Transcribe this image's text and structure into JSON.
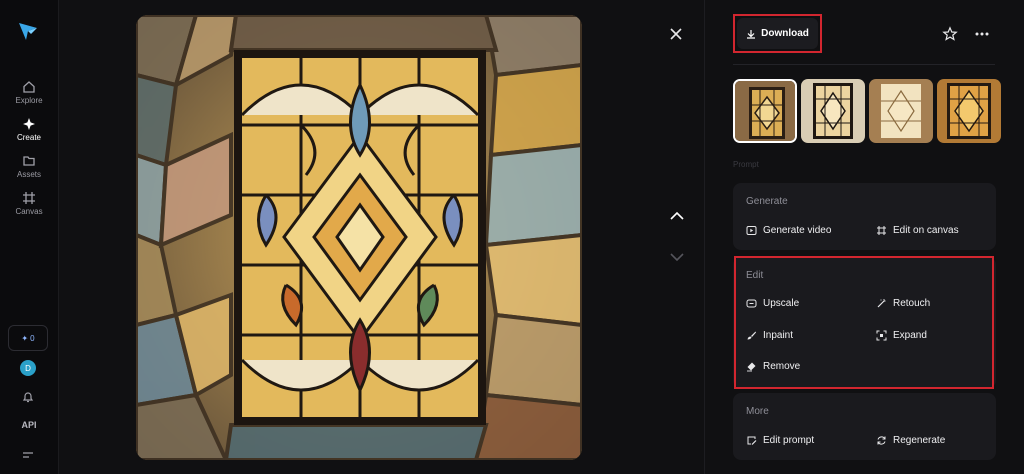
{
  "sidebar": {
    "items": [
      {
        "label": "Explore",
        "icon": "home-icon"
      },
      {
        "label": "Create",
        "icon": "sparkle-icon"
      },
      {
        "label": "Assets",
        "icon": "folder-icon"
      },
      {
        "label": "Canvas",
        "icon": "canvas-icon"
      }
    ],
    "credits": "0",
    "avatar_initial": "D",
    "api_label": "API"
  },
  "toolbar": {
    "download_label": "Download"
  },
  "panel": {
    "prompt_label": "Prompt",
    "generate": {
      "title": "Generate",
      "actions": [
        {
          "label": "Generate video",
          "icon": "video-icon"
        },
        {
          "label": "Edit on canvas",
          "icon": "crop-icon"
        }
      ]
    },
    "edit": {
      "title": "Edit",
      "actions": [
        {
          "label": "Upscale",
          "icon": "upscale-icon"
        },
        {
          "label": "Retouch",
          "icon": "magic-wand-icon"
        },
        {
          "label": "Inpaint",
          "icon": "brush-icon"
        },
        {
          "label": "Expand",
          "icon": "expand-icon"
        },
        {
          "label": "Remove",
          "icon": "eraser-icon"
        }
      ]
    },
    "more": {
      "title": "More",
      "actions": [
        {
          "label": "Edit prompt",
          "icon": "edit-prompt-icon"
        },
        {
          "label": "Regenerate",
          "icon": "refresh-icon"
        }
      ]
    }
  },
  "colors": {
    "highlight": "#d2262f",
    "accent": "#2aa0c8",
    "panel_card": "#1a1a1e"
  }
}
